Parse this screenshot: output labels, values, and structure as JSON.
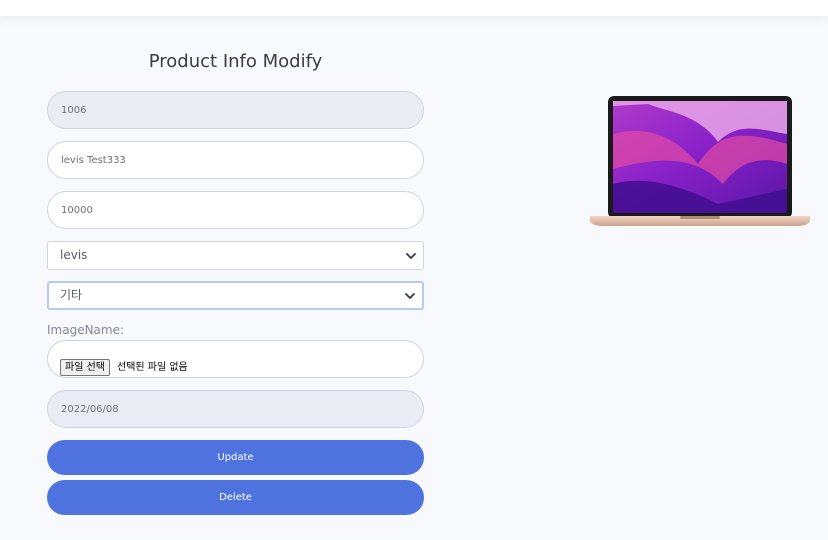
{
  "page": {
    "title": "Product Info Modify"
  },
  "form": {
    "product_id": "1006",
    "product_name": "levis Test333",
    "price": "10000",
    "brand_select": "levis",
    "category_select": "기타",
    "image_label": "ImageName:",
    "file_button": "파일 선택",
    "file_status": "선택된 파일 없음",
    "date": "2022/06/08",
    "update_button": "Update",
    "delete_button": "Delete"
  },
  "colors": {
    "primary": "#4e73df",
    "background": "#f8f9fc",
    "readonly_field": "#eaecf4"
  },
  "icons": {
    "select_arrow": "chevron-down-icon",
    "product_image": "laptop-image"
  }
}
